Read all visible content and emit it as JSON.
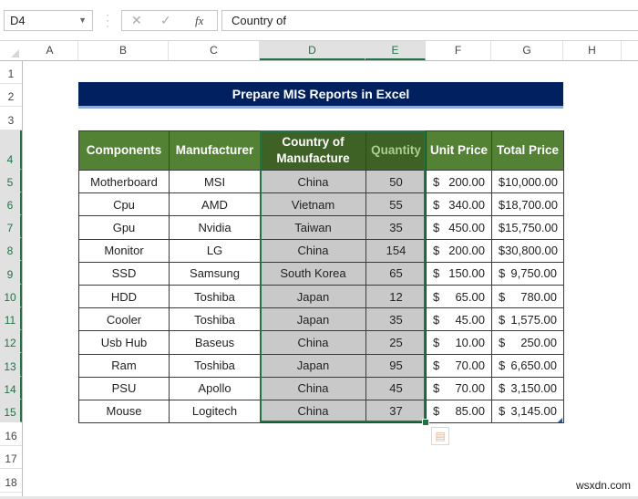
{
  "formula_bar": {
    "name_box": "D4",
    "cancel_icon": "✕",
    "enter_icon": "✓",
    "fx_label": "fx",
    "formula_value": "Country of"
  },
  "columns": [
    "A",
    "B",
    "C",
    "D",
    "E",
    "F",
    "G",
    "H"
  ],
  "rows": [
    "1",
    "2",
    "3",
    "4",
    "5",
    "6",
    "7",
    "8",
    "9",
    "10",
    "11",
    "12",
    "13",
    "14",
    "15",
    "16",
    "17",
    "18"
  ],
  "selected_columns": [
    "D",
    "E"
  ],
  "title": "Prepare MIS Reports in Excel",
  "table": {
    "headers": [
      "Components",
      "Manufacturer",
      "Country of Manufacture",
      "Quantity",
      "Unit Price",
      "Total Price"
    ],
    "rows": [
      {
        "component": "Motherboard",
        "manufacturer": "MSI",
        "country": "China",
        "quantity": "50",
        "unit_price": "200.00",
        "total_price": "$10,000.00"
      },
      {
        "component": "Cpu",
        "manufacturer": "AMD",
        "country": "Vietnam",
        "quantity": "55",
        "unit_price": "340.00",
        "total_price": "$18,700.00"
      },
      {
        "component": "Gpu",
        "manufacturer": "Nvidia",
        "country": "Taiwan",
        "quantity": "35",
        "unit_price": "450.00",
        "total_price": "$15,750.00"
      },
      {
        "component": "Monitor",
        "manufacturer": "LG",
        "country": "China",
        "quantity": "154",
        "unit_price": "200.00",
        "total_price": "$30,800.00"
      },
      {
        "component": "SSD",
        "manufacturer": "Samsung",
        "country": "South Korea",
        "quantity": "65",
        "unit_price": "150.00",
        "total_price": "9,750.00"
      },
      {
        "component": "HDD",
        "manufacturer": "Toshiba",
        "country": "Japan",
        "quantity": "12",
        "unit_price": "65.00",
        "total_price": "780.00"
      },
      {
        "component": "Cooler",
        "manufacturer": "Toshiba",
        "country": "Japan",
        "quantity": "35",
        "unit_price": "45.00",
        "total_price": "1,575.00"
      },
      {
        "component": "Usb Hub",
        "manufacturer": "Baseus",
        "country": "China",
        "quantity": "25",
        "unit_price": "10.00",
        "total_price": "250.00"
      },
      {
        "component": "Ram",
        "manufacturer": "Toshiba",
        "country": "Japan",
        "quantity": "95",
        "unit_price": "70.00",
        "total_price": "6,650.00"
      },
      {
        "component": "PSU",
        "manufacturer": "Apollo",
        "country": "China",
        "quantity": "45",
        "unit_price": "70.00",
        "total_price": "3,150.00"
      },
      {
        "component": "Mouse",
        "manufacturer": "Logitech",
        "country": "China",
        "quantity": "37",
        "unit_price": "85.00",
        "total_price": "3,145.00"
      }
    ],
    "currency_symbol": "$"
  },
  "quick_analysis_icon": "quick-analysis",
  "watermark": "wsxdn.com"
}
